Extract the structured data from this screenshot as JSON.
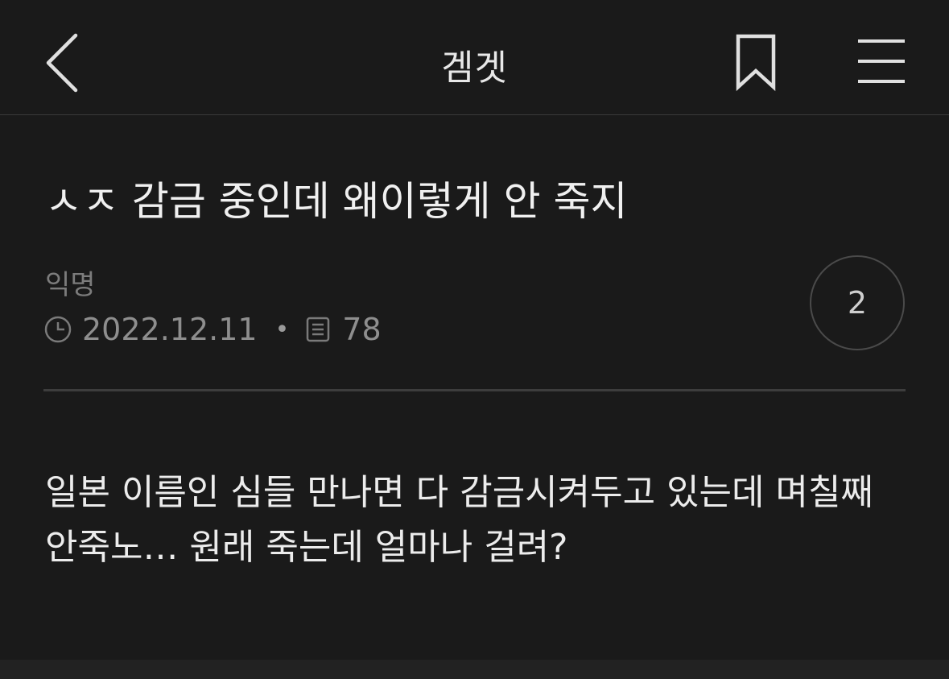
{
  "header": {
    "title": "겜겟",
    "back_icon": "chevron-left-icon",
    "bookmark_icon": "bookmark-icon",
    "menu_icon": "hamburger-menu-icon"
  },
  "post": {
    "title": "ㅅㅈ 감금 중인데 왜이렇게 안 죽지",
    "author": "익명",
    "date": "2022.12.11",
    "separator": "•",
    "views": "78",
    "comment_count": "2",
    "body_lines": [
      "일본 이름인 심들 만나면 다 감금시켜두고 있는데 며칠째",
      "안죽노… 원래 죽는데 얼마나 걸려?"
    ]
  },
  "colors": {
    "background": "#1a1a1a",
    "text_primary": "#f0f0f0",
    "text_secondary": "#8e8e8e",
    "divider": "#3d3d3d"
  }
}
